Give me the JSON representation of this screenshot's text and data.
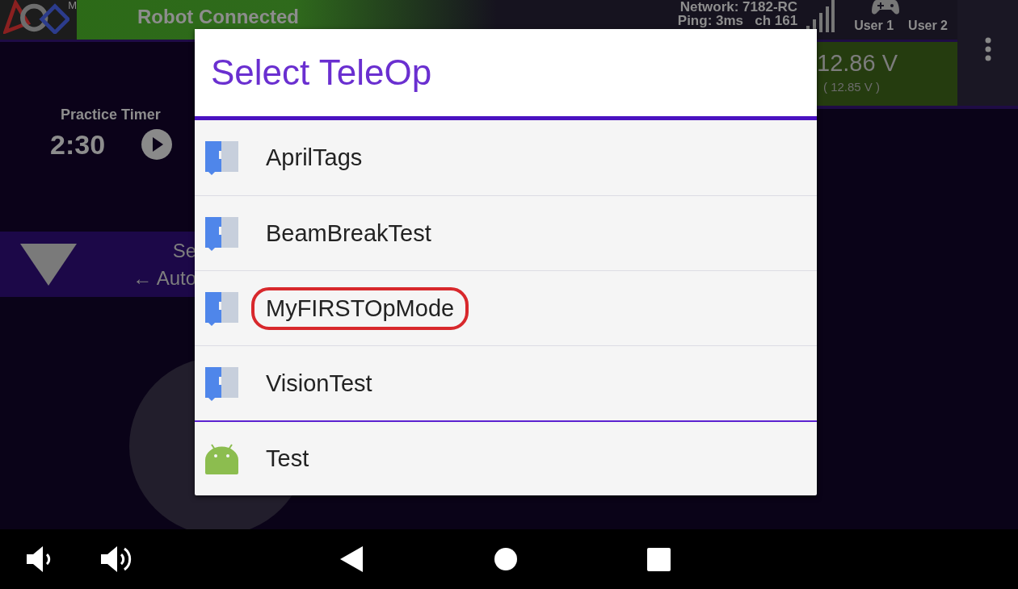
{
  "top_bar": {
    "logo_mark": "M",
    "status": "Robot Connected",
    "network": "Network: 7182-RC",
    "ping": "Ping: 3ms   ch 161",
    "users": [
      "User 1",
      "User 2"
    ]
  },
  "battery": {
    "voltage": "12.86 V",
    "min_voltage": "( 12.85 V )"
  },
  "timer": {
    "label": "Practice Timer",
    "time": "2:30"
  },
  "op_mode_bar": {
    "line_1": "Se",
    "line_2": "← Auto"
  },
  "dialog": {
    "title": "Select TeleOp",
    "items": [
      {
        "label": "AprilTags",
        "kind": "blocks",
        "circled": false,
        "group_start": false
      },
      {
        "label": "BeamBreakTest",
        "kind": "blocks",
        "circled": false,
        "group_start": false
      },
      {
        "label": "MyFIRSTOpMode",
        "kind": "blocks",
        "circled": true,
        "group_start": false
      },
      {
        "label": "VisionTest",
        "kind": "blocks",
        "circled": false,
        "group_start": false
      },
      {
        "label": "Test",
        "kind": "android",
        "circled": false,
        "group_start": true
      }
    ]
  }
}
